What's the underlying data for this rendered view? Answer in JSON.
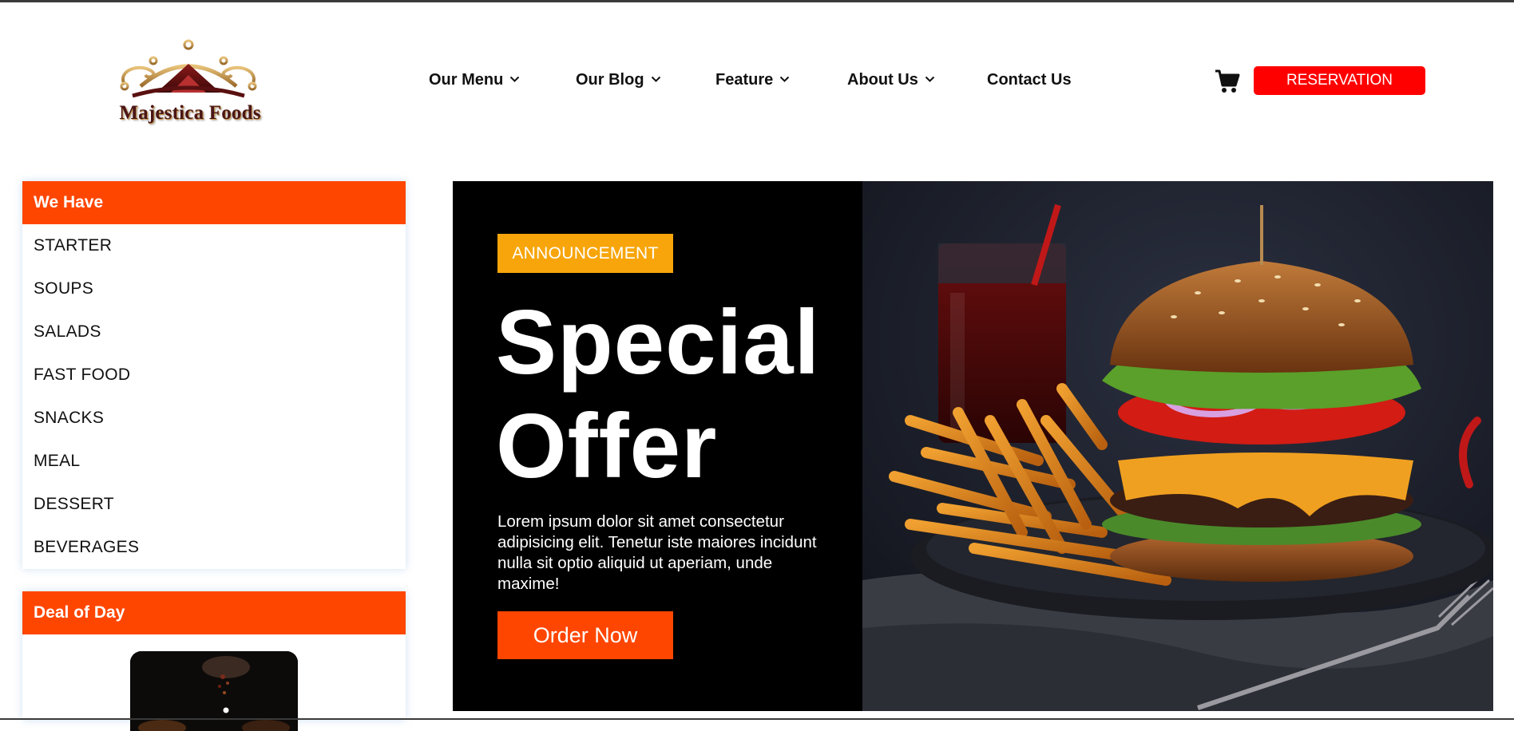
{
  "brand": {
    "name": "Majestica Foods",
    "logo_icon": "crown-logo-icon",
    "colors": {
      "primary": "#ff4600",
      "reservation": "#ff0000",
      "badge": "#f7a50a",
      "hero_bg": "#000000"
    }
  },
  "nav": {
    "items": [
      {
        "label": "Our Menu",
        "dropdown": true
      },
      {
        "label": "Our Blog",
        "dropdown": true
      },
      {
        "label": "Feature",
        "dropdown": true
      },
      {
        "label": "About Us",
        "dropdown": true
      },
      {
        "label": "Contact Us",
        "dropdown": false
      }
    ],
    "cart_icon": "cart-icon",
    "reservation_label": "RESERVATION"
  },
  "sidebar": {
    "categories_title": "We Have",
    "categories": [
      "STARTER",
      "SOUPS",
      "SALADS",
      "FAST FOOD",
      "SNACKS",
      "MEAL",
      "DESSERT",
      "BEVERAGES"
    ],
    "deal_title": "Deal of Day"
  },
  "hero": {
    "badge": "ANNOUNCEMENT",
    "title_line1": "Special",
    "title_line2": "Offer",
    "description": "Lorem ipsum dolor sit amet consectetur adipisicing elit. Tenetur iste maiores incidunt nulla sit optio aliquid ut aperiam, unde maxime!",
    "cta_label": "Order Now",
    "image": "burger-fries-drink-photo"
  }
}
